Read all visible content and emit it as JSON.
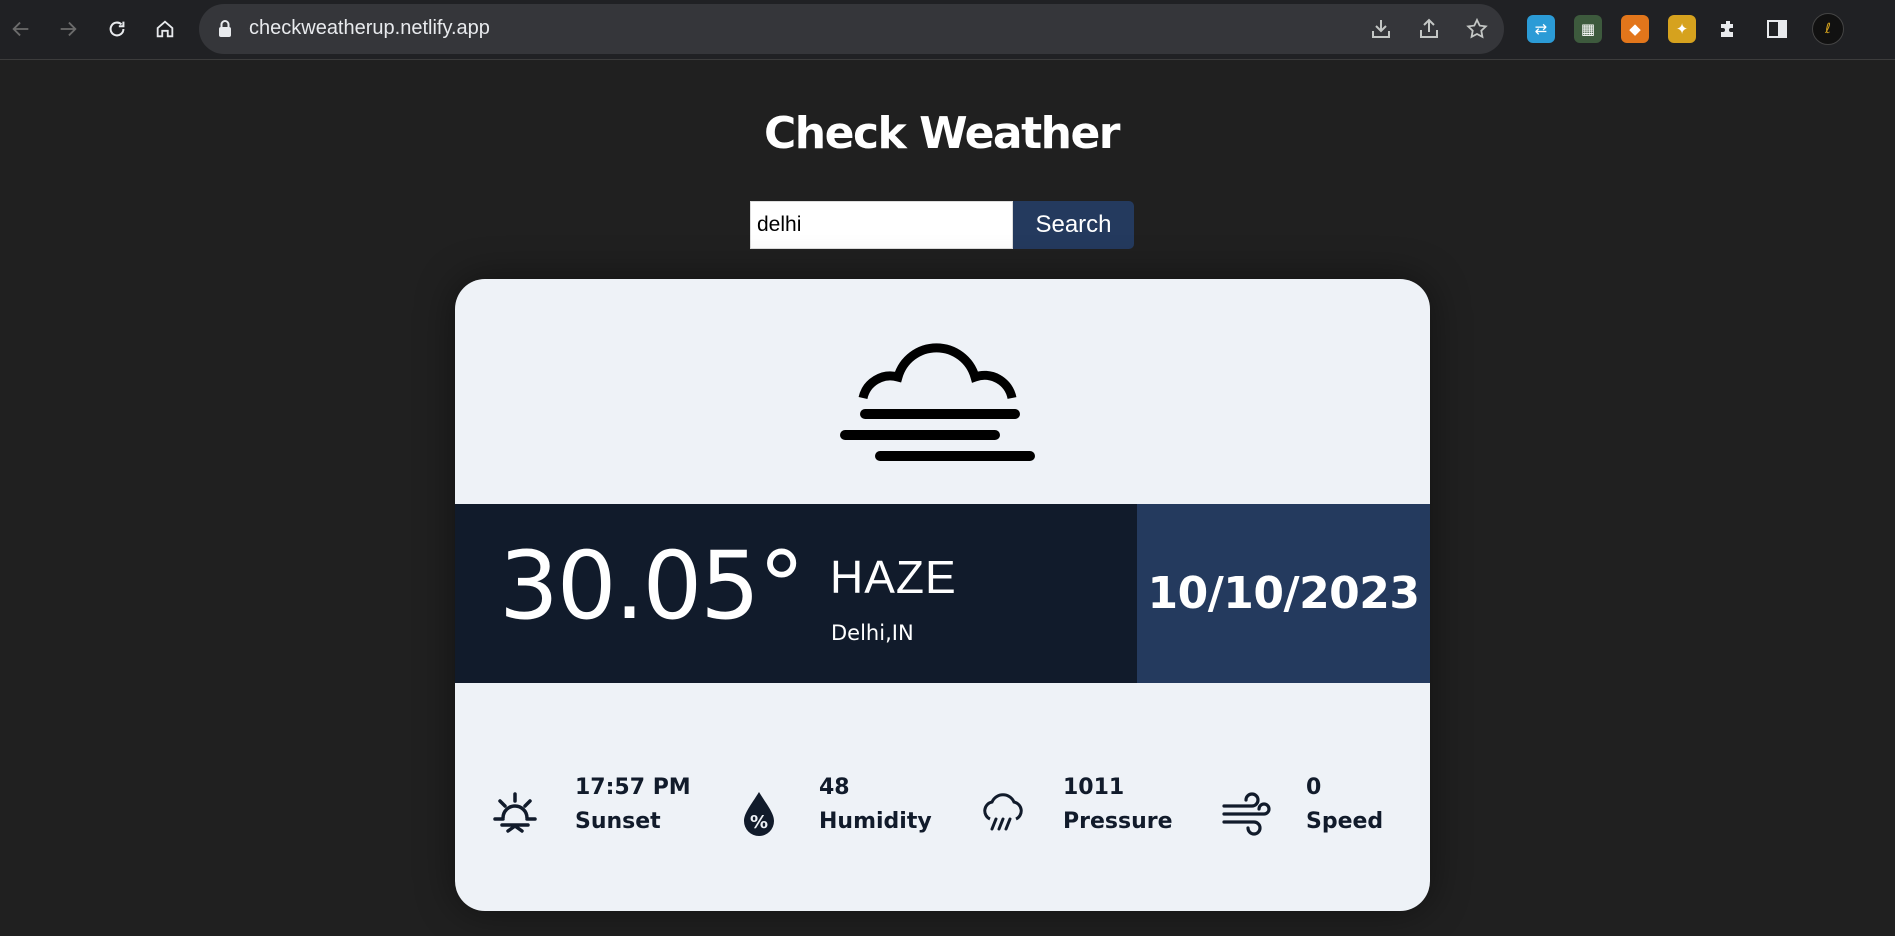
{
  "browser": {
    "url": "checkweatherup.netlify.app"
  },
  "page": {
    "title": "Check Weather"
  },
  "search": {
    "value": "delhi",
    "button_label": "Search"
  },
  "weather": {
    "icon": "haze-icon",
    "temperature": "30.05°",
    "condition": "HAZE",
    "location": "Delhi,IN",
    "date": "10/10/2023"
  },
  "stats": [
    {
      "icon": "sunset-icon",
      "value": "17:57 PM",
      "label": "Sunset"
    },
    {
      "icon": "humidity-icon",
      "value": "48",
      "label": "Humidity"
    },
    {
      "icon": "pressure-icon",
      "value": "1011",
      "label": "Pressure"
    },
    {
      "icon": "wind-icon",
      "value": "0",
      "label": "Speed"
    }
  ],
  "colors": {
    "page_background": "#202020",
    "card_background": "#eef2f7",
    "band_dark": "#111b2b",
    "band_accent": "#243a5e"
  }
}
